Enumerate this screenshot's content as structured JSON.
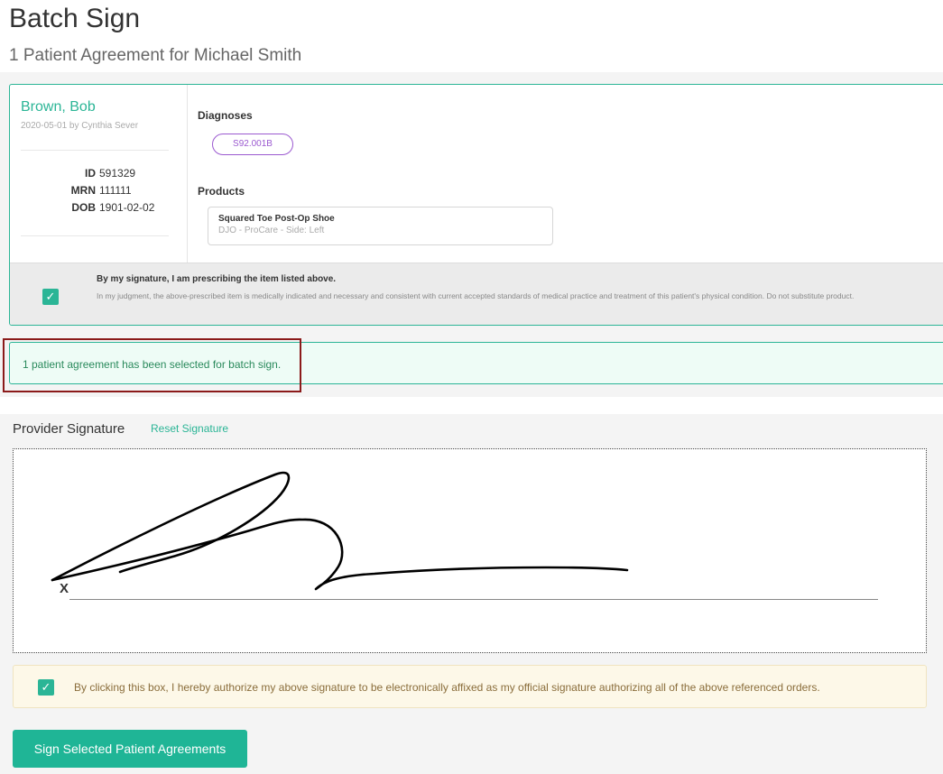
{
  "page": {
    "title": "Batch Sign",
    "subtitle": "1 Patient Agreement for Michael Smith"
  },
  "agreement": {
    "patient_name": "Brown, Bob",
    "meta": "2020-05-01 by Cynthia Sever",
    "fields": [
      {
        "label": "ID",
        "value": "591329"
      },
      {
        "label": "MRN",
        "value": "111111"
      },
      {
        "label": "DOB",
        "value": "1901-02-02"
      }
    ],
    "diagnoses_label": "Diagnoses",
    "diagnoses": [
      "S92.001B"
    ],
    "products_label": "Products",
    "product": {
      "name": "Squared Toe Post-Op Shoe",
      "detail": "DJO - ProCare - Side: Left"
    },
    "attestation_checked": true,
    "attestation_title": "By my signature, I am prescribing the item listed above.",
    "attestation_body": "In my judgment, the above-prescribed item is medically indicated and necessary and consistent with current accepted standards of medical practice and treatment of this patient's physical condition. Do not substitute product."
  },
  "alert": {
    "text": "1 patient agreement has been selected for batch sign."
  },
  "signature": {
    "label": "Provider Signature",
    "reset_label": "Reset Signature",
    "x_mark": "X"
  },
  "authorization": {
    "checked": true,
    "text": "By clicking this box, I hereby authorize my above signature to be electronically affixed as my official signature authorizing all of the above referenced orders."
  },
  "actions": {
    "sign_label": "Sign Selected Patient Agreements"
  },
  "colors": {
    "accent": "#2bb596",
    "diagnosis": "#9b59d0",
    "alert_border": "#2bb596",
    "highlight_frame": "#8b1a1a",
    "auth_background": "#fdf8e8"
  },
  "icons": {
    "checkbox": "check-icon"
  }
}
